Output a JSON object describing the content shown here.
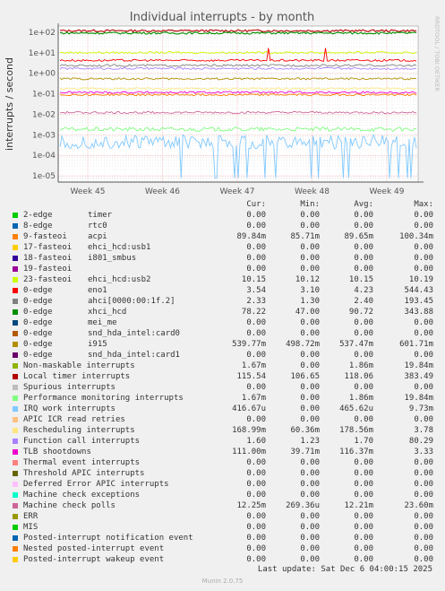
{
  "title": "Individual interrupts - by month",
  "ylabel": "interrupts / second",
  "side_label": "RRDTOOL / TOBI OETIKER",
  "columns": [
    "Cur:",
    "Min:",
    "Avg:",
    "Max:"
  ],
  "last_update": "Last update:  Sat Dec  6 04:00:15 2025",
  "footer": "Munin 2.0.75",
  "rows": [
    {
      "name": "2-edge",
      "device": "timer",
      "cur": "0.00",
      "min": "0.00",
      "avg": "0.00",
      "max": "0.00",
      "color": "#00cc00"
    },
    {
      "name": "8-edge",
      "device": "rtc0",
      "cur": "0.00",
      "min": "0.00",
      "avg": "0.00",
      "max": "0.00",
      "color": "#0066b3"
    },
    {
      "name": "9-fasteoi",
      "device": "acpi",
      "cur": "89.84m",
      "min": "85.71m",
      "avg": "89.65m",
      "max": "100.34m",
      "color": "#ff8000"
    },
    {
      "name": "17-fasteoi",
      "device": "ehci_hcd:usb1",
      "cur": "0.00",
      "min": "0.00",
      "avg": "0.00",
      "max": "0.00",
      "color": "#ffcc00"
    },
    {
      "name": "18-fasteoi",
      "device": "i801_smbus",
      "cur": "0.00",
      "min": "0.00",
      "avg": "0.00",
      "max": "0.00",
      "color": "#330099"
    },
    {
      "name": "19-fasteoi",
      "device": "",
      "cur": "0.00",
      "min": "0.00",
      "avg": "0.00",
      "max": "0.00",
      "color": "#990099"
    },
    {
      "name": "23-fasteoi",
      "device": "ehci_hcd:usb2",
      "cur": "10.15",
      "min": "10.12",
      "avg": "10.15",
      "max": "10.19",
      "color": "#ccff00"
    },
    {
      "name": "0-edge",
      "device": "eno1",
      "cur": "3.54",
      "min": "3.10",
      "avg": "4.23",
      "max": "544.43",
      "color": "#ff0000"
    },
    {
      "name": "0-edge",
      "device": "ahci[0000:00:1f.2]",
      "cur": "2.33",
      "min": "1.30",
      "avg": "2.40",
      "max": "193.45",
      "color": "#808080"
    },
    {
      "name": "0-edge",
      "device": "xhci_hcd",
      "cur": "78.22",
      "min": "47.00",
      "avg": "90.72",
      "max": "343.88",
      "color": "#008f00"
    },
    {
      "name": "0-edge",
      "device": "mei_me",
      "cur": "0.00",
      "min": "0.00",
      "avg": "0.00",
      "max": "0.00",
      "color": "#00487d"
    },
    {
      "name": "0-edge",
      "device": "snd_hda_intel:card0",
      "cur": "0.00",
      "min": "0.00",
      "avg": "0.00",
      "max": "0.00",
      "color": "#b35a00"
    },
    {
      "name": "0-edge",
      "device": "i915",
      "cur": "539.77m",
      "min": "498.72m",
      "avg": "537.47m",
      "max": "601.71m",
      "color": "#b38f00"
    },
    {
      "name": "0-edge",
      "device": "snd_hda_intel:card1",
      "cur": "0.00",
      "min": "0.00",
      "avg": "0.00",
      "max": "0.00",
      "color": "#6b006b"
    },
    {
      "name": "Non-maskable interrupts",
      "device": "",
      "cur": "1.67m",
      "min": "0.00",
      "avg": "1.86m",
      "max": "19.84m",
      "color": "#8fb300"
    },
    {
      "name": "Local timer interrupts",
      "device": "",
      "cur": "115.54",
      "min": "106.65",
      "avg": "118.06",
      "max": "383.49",
      "color": "#b30000"
    },
    {
      "name": "Spurious interrupts",
      "device": "",
      "cur": "0.00",
      "min": "0.00",
      "avg": "0.00",
      "max": "0.00",
      "color": "#bebebe"
    },
    {
      "name": "Performance monitoring interrupts",
      "device": "",
      "cur": "1.67m",
      "min": "0.00",
      "avg": "1.86m",
      "max": "19.84m",
      "color": "#80ff80"
    },
    {
      "name": "IRQ work interrupts",
      "device": "",
      "cur": "416.67u",
      "min": "0.00",
      "avg": "465.62u",
      "max": "9.73m",
      "color": "#80c9ff"
    },
    {
      "name": "APIC ICR read retries",
      "device": "",
      "cur": "0.00",
      "min": "0.00",
      "avg": "0.00",
      "max": "0.00",
      "color": "#ffc080"
    },
    {
      "name": "Rescheduling interrupts",
      "device": "",
      "cur": "168.99m",
      "min": "60.36m",
      "avg": "178.56m",
      "max": "3.78",
      "color": "#ffe680"
    },
    {
      "name": "Function call interrupts",
      "device": "",
      "cur": "1.60",
      "min": "1.23",
      "avg": "1.70",
      "max": "80.29",
      "color": "#aa80ff"
    },
    {
      "name": "TLB shootdowns",
      "device": "",
      "cur": "111.00m",
      "min": "39.71m",
      "avg": "116.37m",
      "max": "3.33",
      "color": "#ee00cc"
    },
    {
      "name": "Thermal event interrupts",
      "device": "",
      "cur": "0.00",
      "min": "0.00",
      "avg": "0.00",
      "max": "0.00",
      "color": "#ff8080"
    },
    {
      "name": "Threshold APIC interrupts",
      "device": "",
      "cur": "0.00",
      "min": "0.00",
      "avg": "0.00",
      "max": "0.00",
      "color": "#666600"
    },
    {
      "name": "Deferred Error APIC interrupts",
      "device": "",
      "cur": "0.00",
      "min": "0.00",
      "avg": "0.00",
      "max": "0.00",
      "color": "#ffbfff"
    },
    {
      "name": "Machine check exceptions",
      "device": "",
      "cur": "0.00",
      "min": "0.00",
      "avg": "0.00",
      "max": "0.00",
      "color": "#00ffcc"
    },
    {
      "name": "Machine check polls",
      "device": "",
      "cur": "12.25m",
      "min": "269.36u",
      "avg": "12.21m",
      "max": "23.60m",
      "color": "#cc6699"
    },
    {
      "name": "ERR",
      "device": "",
      "cur": "0.00",
      "min": "0.00",
      "avg": "0.00",
      "max": "0.00",
      "color": "#999900"
    },
    {
      "name": "MIS",
      "device": "",
      "cur": "0.00",
      "min": "0.00",
      "avg": "0.00",
      "max": "0.00",
      "color": "#00cc00"
    },
    {
      "name": "Posted-interrupt notification event",
      "device": "",
      "cur": "0.00",
      "min": "0.00",
      "avg": "0.00",
      "max": "0.00",
      "color": "#0066b3"
    },
    {
      "name": "Nested posted-interrupt event",
      "device": "",
      "cur": "0.00",
      "min": "0.00",
      "avg": "0.00",
      "max": "0.00",
      "color": "#ff8000"
    },
    {
      "name": "Posted-interrupt wakeup event",
      "device": "",
      "cur": "0.00",
      "min": "0.00",
      "avg": "0.00",
      "max": "0.00",
      "color": "#ffcc00"
    }
  ],
  "chart_data": {
    "type": "line",
    "title": "Individual interrupts - by month",
    "ylabel": "interrupts / second",
    "yscale": "log",
    "ylim": [
      5e-06,
      200
    ],
    "yticks": [
      "1e+02",
      "1e+01",
      "1e+00",
      "1e-01",
      "1e-02",
      "1e-03",
      "1e-04",
      "1e-05"
    ],
    "xticks": [
      "Week 45",
      "Week 46",
      "Week 47",
      "Week 48",
      "Week 49"
    ],
    "grid": true,
    "series": [
      {
        "name": "Local timer interrupts",
        "color": "#b30000",
        "avg": 118.06
      },
      {
        "name": "0-edge xhci_hcd",
        "color": "#008f00",
        "avg": 90.72
      },
      {
        "name": "23-fasteoi ehci_hcd:usb2",
        "color": "#ccff00",
        "avg": 10.15
      },
      {
        "name": "0-edge eno1",
        "color": "#ff0000",
        "avg": 4.23
      },
      {
        "name": "0-edge ahci[0000:00:1f.2]",
        "color": "#808080",
        "avg": 2.4
      },
      {
        "name": "Function call interrupts",
        "color": "#aa80ff",
        "avg": 1.7
      },
      {
        "name": "0-edge i915",
        "color": "#b38f00",
        "avg": 0.53747
      },
      {
        "name": "Rescheduling interrupts",
        "color": "#ffe680",
        "avg": 0.17856
      },
      {
        "name": "TLB shootdowns",
        "color": "#ee00cc",
        "avg": 0.11637
      },
      {
        "name": "9-fasteoi acpi",
        "color": "#ff8000",
        "avg": 0.08965
      },
      {
        "name": "Machine check polls",
        "color": "#cc6699",
        "avg": 0.01221
      },
      {
        "name": "Performance monitoring interrupts",
        "color": "#80ff80",
        "avg": 0.00186
      },
      {
        "name": "IRQ work interrupts",
        "color": "#80c9ff",
        "avg": 0.00046562
      }
    ]
  }
}
